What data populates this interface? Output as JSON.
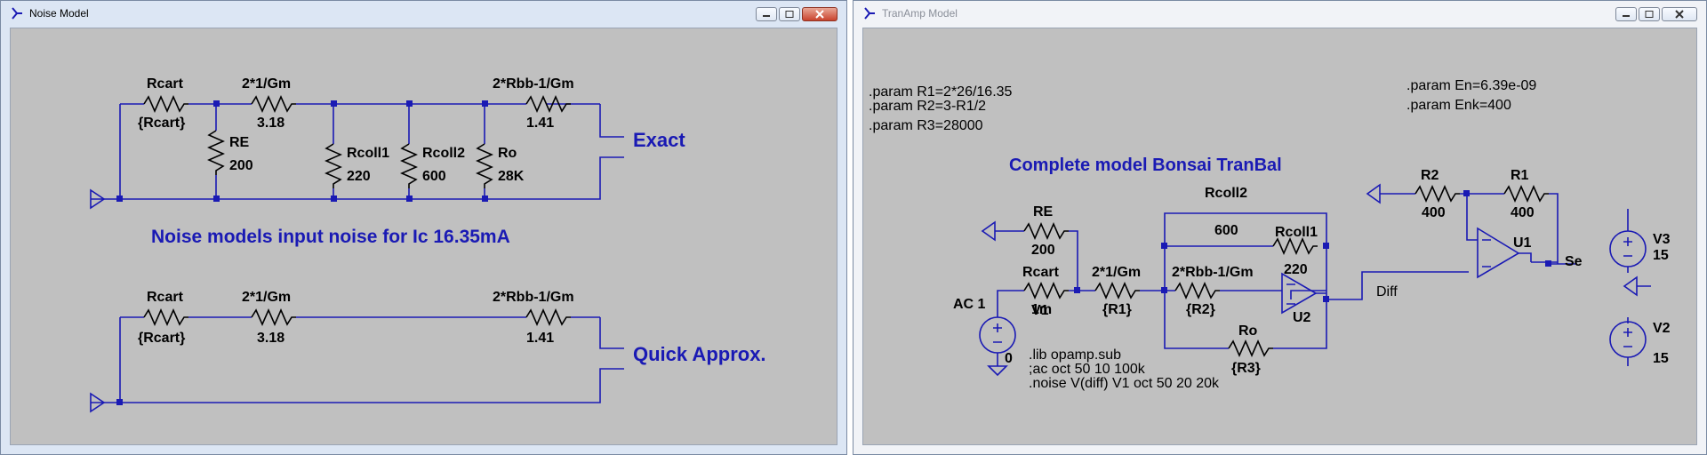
{
  "windows": {
    "noise": {
      "title": "Noise Model",
      "exact": {
        "rcart_name": "Rcart",
        "rcart_value": "{Rcart}",
        "gm_name": "2*1/Gm",
        "gm_value": "3.18",
        "re_name": "RE",
        "re_value": "200",
        "rcoll1_name": "Rcoll1",
        "rcoll1_value": "220",
        "rcoll2_name": "Rcoll2",
        "rcoll2_value": "600",
        "ro_name": "Ro",
        "ro_value": "28K",
        "rbb_name": "2*Rbb-1/Gm",
        "rbb_value": "1.41",
        "label": "Exact"
      },
      "heading": "Noise models input noise for Ic 16.35mA",
      "approx": {
        "rcart_name": "Rcart",
        "rcart_value": "{Rcart}",
        "gm_name": "2*1/Gm",
        "gm_value": "3.18",
        "rbb_name": "2*Rbb-1/Gm",
        "rbb_value": "1.41",
        "label": "Quick Approx."
      }
    },
    "tranamp": {
      "title": "TranAmp Model",
      "params_left": [
        ".param R1=2*26/16.35",
        ".param R2=3-R1/2",
        ".param R3=28000"
      ],
      "params_right": [
        ".param En=6.39e-09",
        ".param Enk=400"
      ],
      "heading": "Complete model Bonsai TranBal",
      "re_name": "RE",
      "re_value": "200",
      "rcart_name": "Rcart",
      "rcart_value": "1m",
      "gm_name": "2*1/Gm",
      "gm_value": "{R1}",
      "rcoll2_name": "Rcoll2",
      "rcoll2_value": "600",
      "rcoll1_name": "Rcoll1",
      "rcoll1_value": "220",
      "rbb_name": "2*Rbb-1/Gm",
      "rbb_value": "{R2}",
      "ro_name": "Ro",
      "ro_value": "{R3}",
      "u2": "U2",
      "diff": "Diff",
      "r2_name": "R2",
      "r2_value": "400",
      "r1_name": "R1",
      "r1_value": "400",
      "u1": "U1",
      "se": "Se",
      "v1_ac": "AC 1",
      "v1_name": "V1",
      "v1_value": "0",
      "v3_name": "V3",
      "v3_value": "15",
      "v2_name": "V2",
      "v2_value": "15",
      "directives": [
        ".lib opamp.sub",
        ";ac oct 50 10 100k",
        ".noise V(diff) V1 oct 50 20 20k"
      ]
    }
  },
  "colors": {
    "wire": "#1a1ab4",
    "canvas": "#c0c0c0"
  }
}
